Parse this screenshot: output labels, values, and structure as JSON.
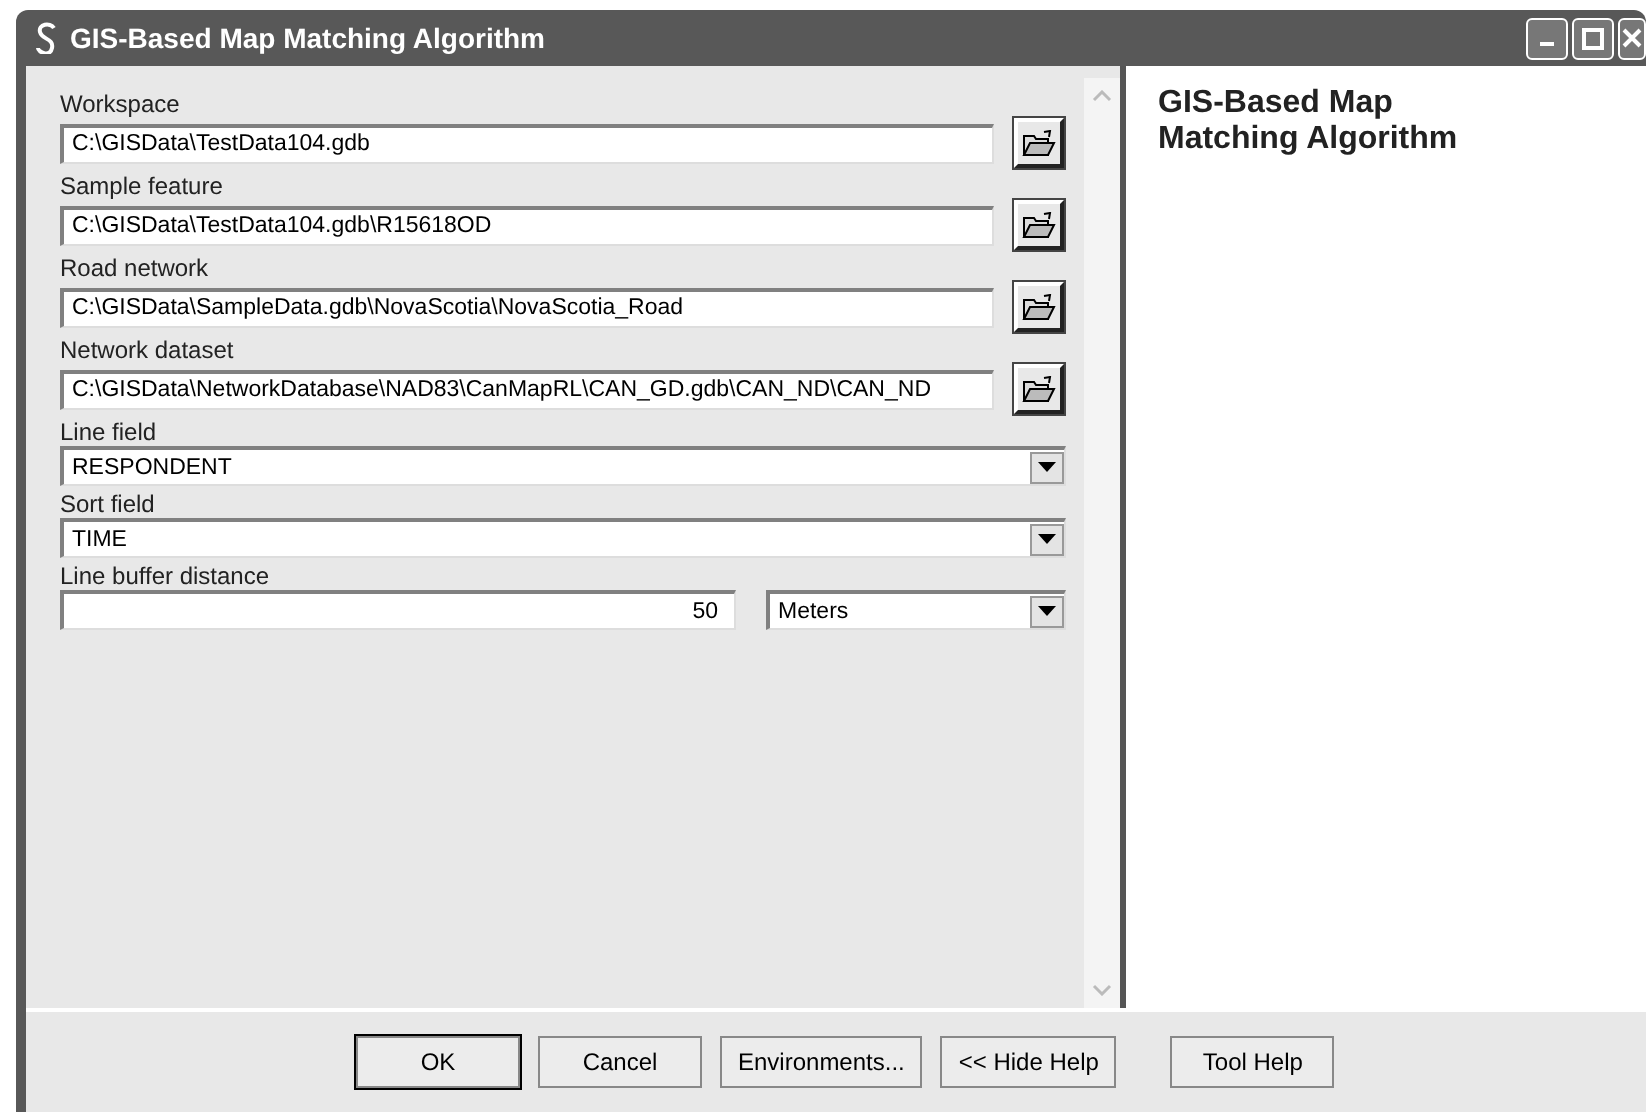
{
  "window": {
    "title": "GIS-Based Map Matching Algorithm"
  },
  "parameters": [
    {
      "kind": "path",
      "label": "Workspace",
      "value": "C:\\GISData\\TestData104.gdb"
    },
    {
      "kind": "path",
      "label": "Sample feature",
      "value": "C:\\GISData\\TestData104.gdb\\R15618OD"
    },
    {
      "kind": "path",
      "label": "Road network",
      "value": "C:\\GISData\\SampleData.gdb\\NovaScotia\\NovaScotia_Road"
    },
    {
      "kind": "path",
      "label": "Network dataset",
      "value": "C:\\GISData\\NetworkDatabase\\NAD83\\CanMapRL\\CAN_GD.gdb\\CAN_ND\\CAN_ND"
    },
    {
      "kind": "dropdown",
      "label": "Line field",
      "value": "RESPONDENT"
    },
    {
      "kind": "dropdown",
      "label": "Sort field",
      "value": "TIME"
    },
    {
      "kind": "linear",
      "label": "Line buffer distance",
      "value": "50",
      "unit": "Meters"
    }
  ],
  "help": {
    "title": "GIS-Based Map Matching Algorithm"
  },
  "buttons": [
    {
      "label": "OK",
      "default": true
    },
    {
      "label": "Cancel",
      "default": false
    },
    {
      "label": "Environments...",
      "default": false
    },
    {
      "label": "<< Hide Help",
      "default": false
    },
    {
      "label": "Tool Help",
      "default": false
    }
  ]
}
